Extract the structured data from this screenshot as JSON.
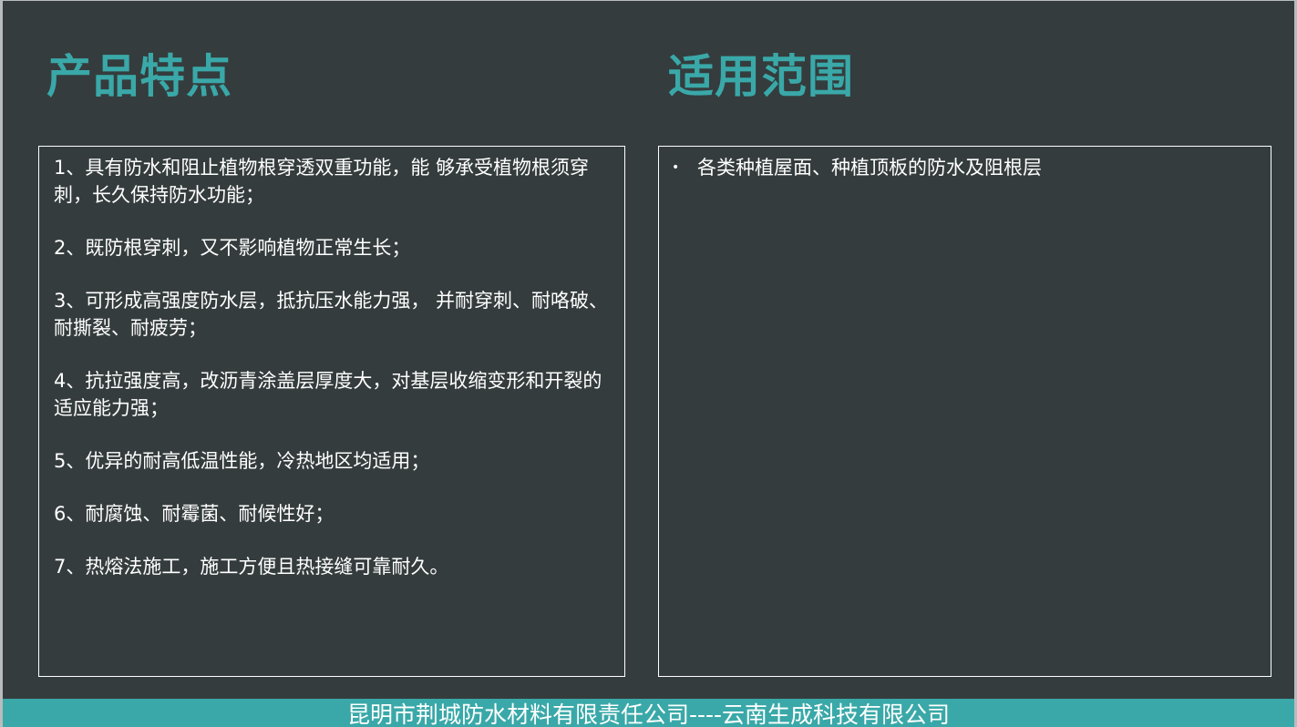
{
  "left_section": {
    "title": "产品特点",
    "items": [
      "1、具有防水和阻止植物根穿透双重功能，能  够承受植物根须穿刺，长久保持防水功能；",
      "2、既防根穿刺，又不影响植物正常生长；",
      "3、可形成高强度防水层，抵抗压水能力强，  并耐穿刺、耐咯破、耐撕裂、耐疲劳；",
      "4、抗拉强度高，改沥青涂盖层厚度大，对基层收缩变形和开裂的适应能力强；",
      "5、优异的耐高低温性能，冷热地区均适用；",
      "6、耐腐蚀、耐霉菌、耐候性好；",
      "7、热熔法施工，施工方便且热接缝可靠耐久。"
    ]
  },
  "right_section": {
    "title": "适用范围",
    "bullet": "•",
    "items": [
      "各类种植屋面、种植顶板的防水及阻根层"
    ]
  },
  "footer": {
    "text": "昆明市荆城防水材料有限责任公司----云南生成科技有限公司"
  },
  "colors": {
    "background": "#353c3d",
    "accent": "#3aa8a8",
    "text": "#ffffff"
  }
}
